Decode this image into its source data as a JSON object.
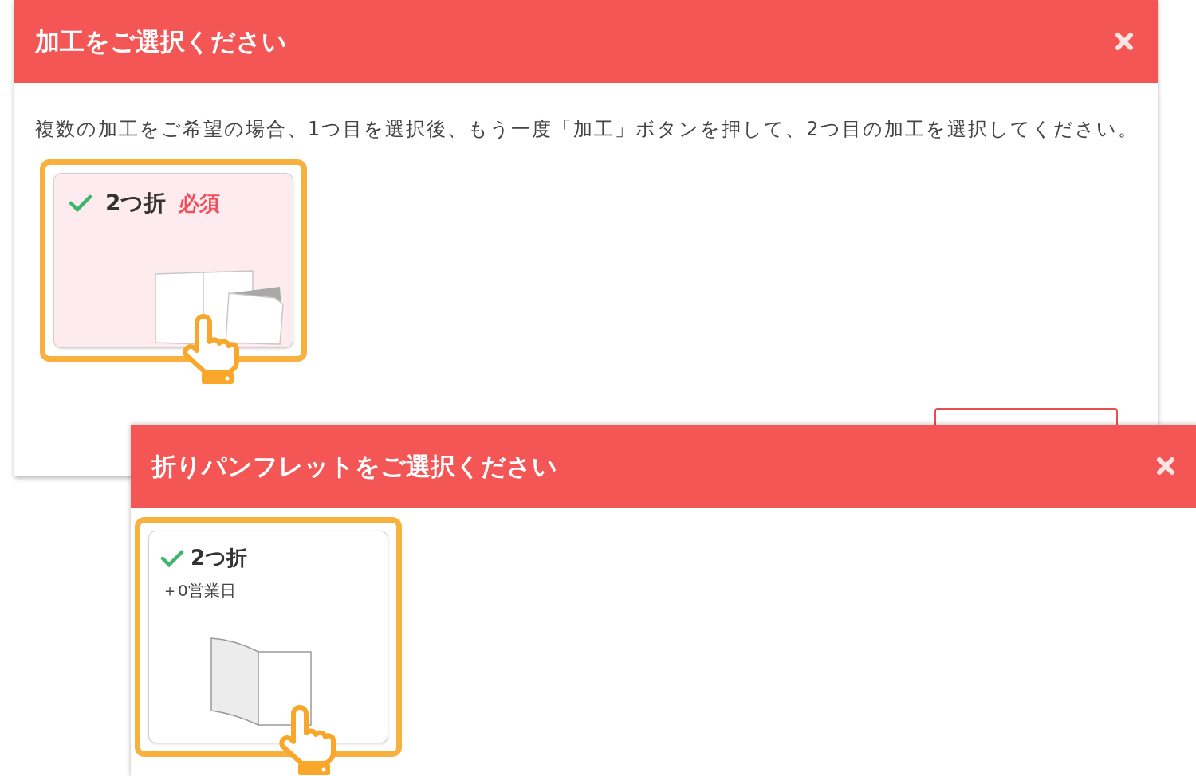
{
  "dialogs": [
    {
      "title": "加工をご選択ください",
      "description": "複数の加工をご希望の場合、1つ目を選択後、もう一度「加工」ボタンを押して、2つ目の加工を選択してください。",
      "options": [
        {
          "kind": "open-and-folded",
          "label": "2つ折",
          "badge": "必須",
          "checked": true,
          "selected": true,
          "highlighted": true
        }
      ],
      "footer_buttons": [
        {
          "kind": "outline"
        }
      ]
    },
    {
      "title": "折りパンフレットをご選択ください",
      "options": [
        {
          "kind": "half-open",
          "label": "2つ折",
          "note": "＋0営業日",
          "checked": true,
          "selected": false,
          "highlighted": true
        }
      ]
    }
  ]
}
